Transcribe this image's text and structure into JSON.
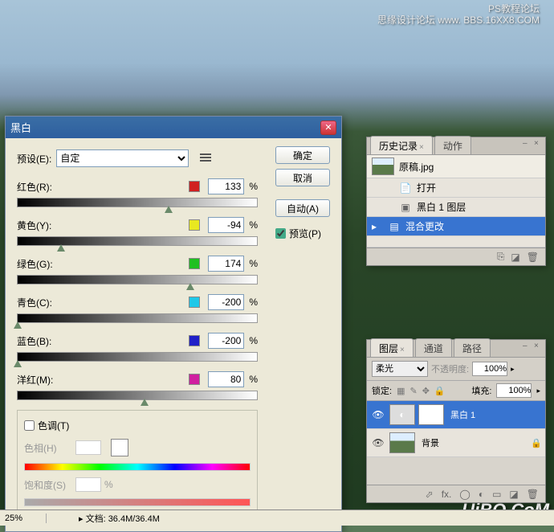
{
  "watermark": {
    "line1": "PS教程论坛",
    "line2": "思缘设计论坛  www.  BBS.16XX8.COM",
    "bottom": "UiBQ.CoM"
  },
  "dialog": {
    "title": "黑白",
    "preset_label": "预设(E):",
    "preset_value": "自定",
    "ok": "确定",
    "cancel": "取消",
    "auto": "自动(A)",
    "preview": "预览(P)",
    "sliders": [
      {
        "label": "红色(R):",
        "color": "#d02020",
        "value": "133",
        "pos": 63
      },
      {
        "label": "黄色(Y):",
        "color": "#e8e820",
        "value": "-94",
        "pos": 18
      },
      {
        "label": "绿色(G):",
        "color": "#20c020",
        "value": "174",
        "pos": 72
      },
      {
        "label": "青色(C):",
        "color": "#20c8e8",
        "value": "-200",
        "pos": 0
      },
      {
        "label": "蓝色(B):",
        "color": "#2020c8",
        "value": "-200",
        "pos": 0
      },
      {
        "label": "洋红(M):",
        "color": "#d020a0",
        "value": "80",
        "pos": 53
      }
    ],
    "tint_label": "色调(T)",
    "hue_label": "色相(H)",
    "sat_label": "饱和度(S)",
    "pct": "%"
  },
  "history": {
    "tab1": "历史记录",
    "tab2": "动作",
    "snapshot": "原稿.jpg",
    "items": [
      "打开",
      "黑白 1 图层",
      "混合更改"
    ]
  },
  "layers": {
    "tab1": "图层",
    "tab2": "通道",
    "tab3": "路径",
    "blend": "柔光",
    "opacity_label": "不透明度:",
    "opacity": "100%",
    "lock_label": "锁定:",
    "fill_label": "填充:",
    "fill": "100%",
    "layer_bw": "黑白 1",
    "layer_bg": "背景"
  },
  "status": {
    "zoom": "25%",
    "doc": "文档: 36.4M/36.4M"
  }
}
